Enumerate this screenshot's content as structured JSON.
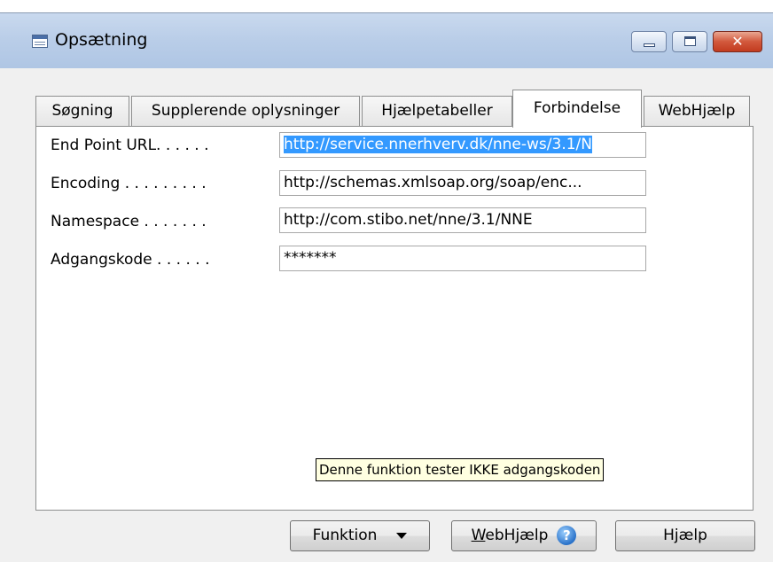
{
  "window": {
    "title": "Opsætning",
    "minimize_icon": "minimize-icon",
    "maximize_icon": "maximize-icon",
    "close_icon": "close-icon"
  },
  "tabs": [
    {
      "label": "Søgning"
    },
    {
      "label": "Supplerende oplysninger"
    },
    {
      "label": "Hjælpetabeller"
    },
    {
      "label": "Forbindelse",
      "active": true
    },
    {
      "label": "WebHjælp"
    }
  ],
  "fields": [
    {
      "label": "End Point URL. . . . . .",
      "value": "http://service.nnerhverv.dk/nne-ws/3.1/N"
    },
    {
      "label": "Encoding . . . . . . . . .",
      "value": "http://schemas.xmlsoap.org/soap/enc..."
    },
    {
      "label": "Namespace . . . . . . .",
      "value": "http://com.stibo.net/nne/3.1/NNE"
    },
    {
      "label": "Adgangskode . . . . . .",
      "value": "*******"
    }
  ],
  "tooltip": "Denne funktion tester IKKE adgangskoden",
  "buttons": {
    "funktion": "Funktion",
    "webhjaelp_underlined": "W",
    "webhjaelp_rest": "ebHjælp",
    "hjaelp": "Hjælp"
  },
  "colors": {
    "selection": "#3399ff",
    "tooltip_bg": "#ffffe1",
    "titlebar": "#b9cde8"
  }
}
